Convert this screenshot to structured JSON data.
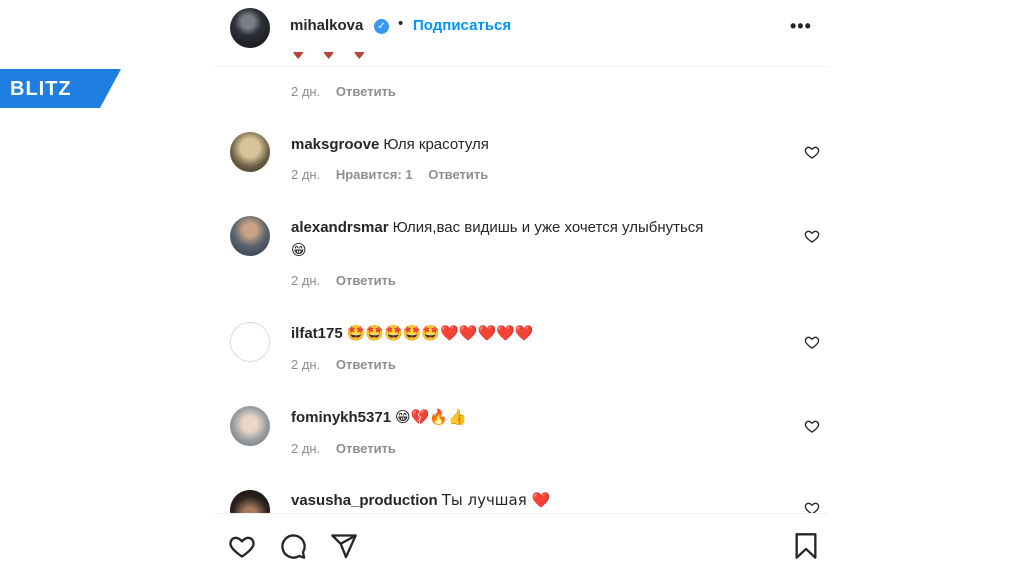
{
  "watermark": {
    "text": "BLITZ",
    "color": "#1e7fe0"
  },
  "header": {
    "username": "mihalkova",
    "verified": true,
    "separator": "•",
    "follow_label": "Подписаться",
    "more_label": "•••"
  },
  "top_partial": {
    "meta": {
      "time": "2 дн.",
      "reply": "Ответить"
    }
  },
  "comments": [
    {
      "username": "maksgroove",
      "text": "Юля красотуля",
      "time": "2 дн.",
      "likes": "Нравится: 1",
      "reply": "Ответить"
    },
    {
      "username": "alexandrsmar",
      "text": "Юлия,вас видишь и уже хочется улыбнуться",
      "text2": "😁",
      "time": "2 дн.",
      "reply": "Ответить"
    },
    {
      "username": "ilfat175",
      "text": "🤩🤩🤩🤩🤩❤️❤️❤️❤️❤️",
      "time": "2 дн.",
      "reply": "Ответить"
    },
    {
      "username": "fominykh5371",
      "text": "😁💔🔥👍",
      "time": "2 дн.",
      "reply": "Ответить"
    },
    {
      "username": "vasusha_production",
      "text": "Ты лучшая ❤️"
    }
  ],
  "footer_icons": [
    "heart-icon",
    "comment-icon",
    "share-icon",
    "bookmark-icon"
  ],
  "colors": {
    "accent": "#0095f6",
    "verified": "#3897f0",
    "muted": "#8e8e8e",
    "text": "#262626"
  }
}
